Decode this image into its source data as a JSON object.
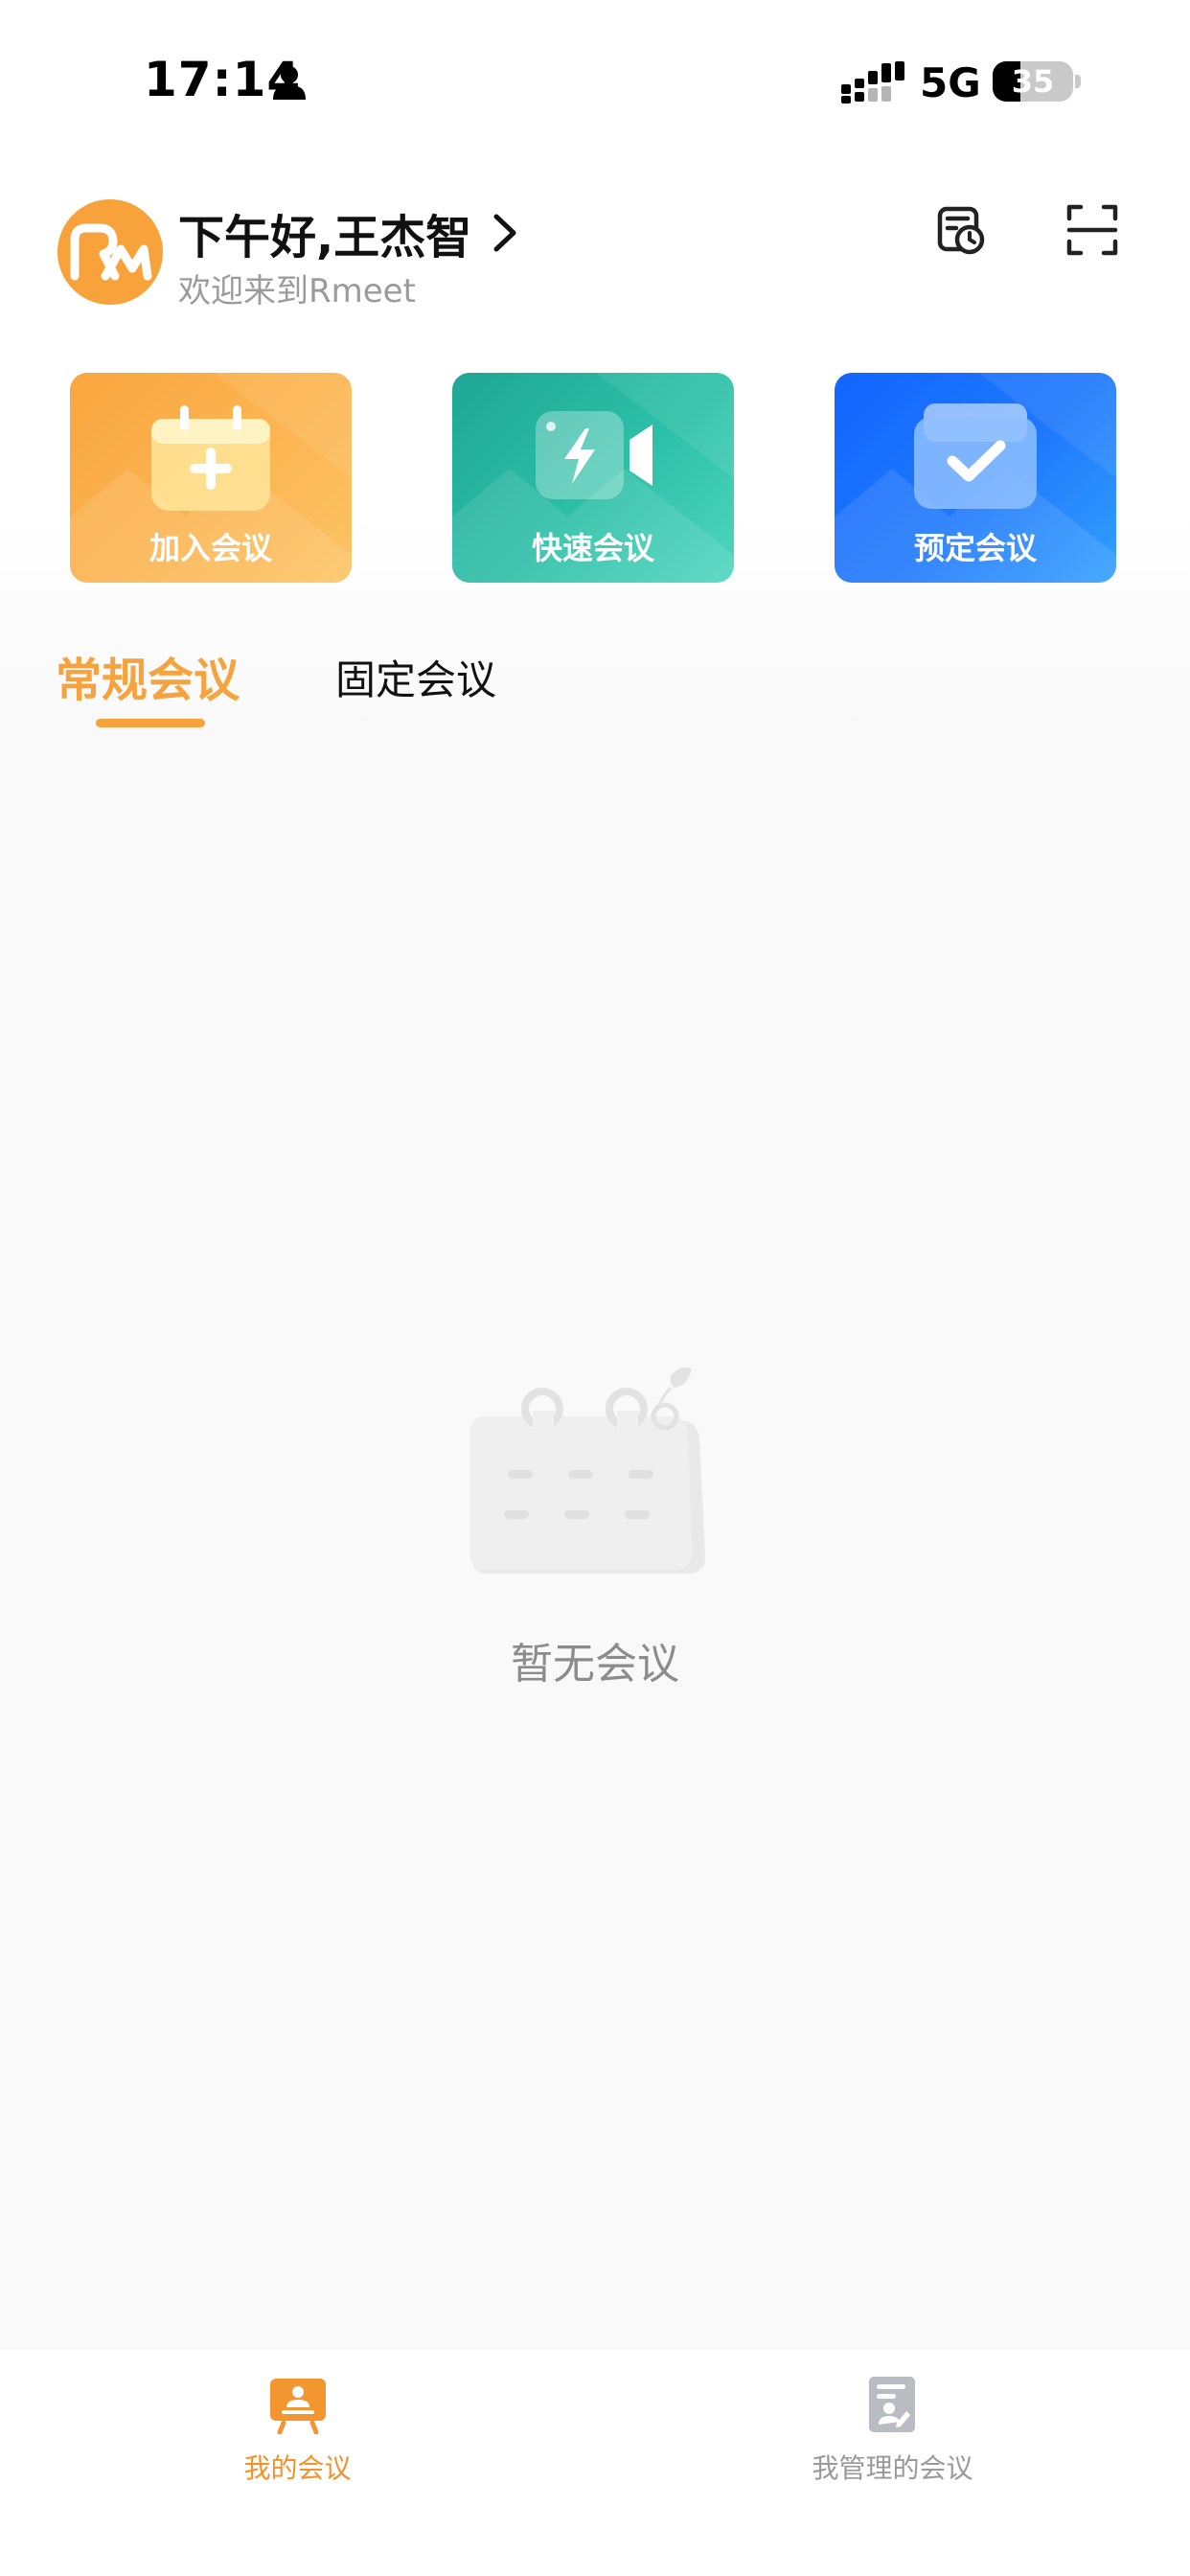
{
  "status_bar": {
    "time": "17:14",
    "network": "5G",
    "battery": "35",
    "battery_level": 0.35
  },
  "header": {
    "greeting": "下午好,王杰智",
    "welcome": "欢迎来到Rmeet",
    "avatar_icon": "rmeet-logo-icon",
    "history_icon": "meeting-history-icon",
    "scan_icon": "scan-icon"
  },
  "actions": [
    {
      "label": "加入会议",
      "icon": "calendar-plus-icon"
    },
    {
      "label": "快速会议",
      "icon": "video-flash-icon"
    },
    {
      "label": "预定会议",
      "icon": "calendar-check-icon"
    }
  ],
  "tabs": [
    {
      "label": "常规会议",
      "active": true
    },
    {
      "label": "固定会议",
      "active": false
    }
  ],
  "empty_state": {
    "text": "暂无会议",
    "icon": "empty-calendar-icon"
  },
  "bottom_nav": [
    {
      "label": "我的会议",
      "icon": "my-meetings-icon",
      "active": true
    },
    {
      "label": "我管理的会议",
      "icon": "managed-meetings-icon",
      "active": false
    }
  ],
  "colors": {
    "accent": "#f6a23d",
    "join_card": "#f9a63f",
    "quick_card": "#1ea794",
    "book_card": "#1265ff",
    "background": "#f9f9f9"
  }
}
